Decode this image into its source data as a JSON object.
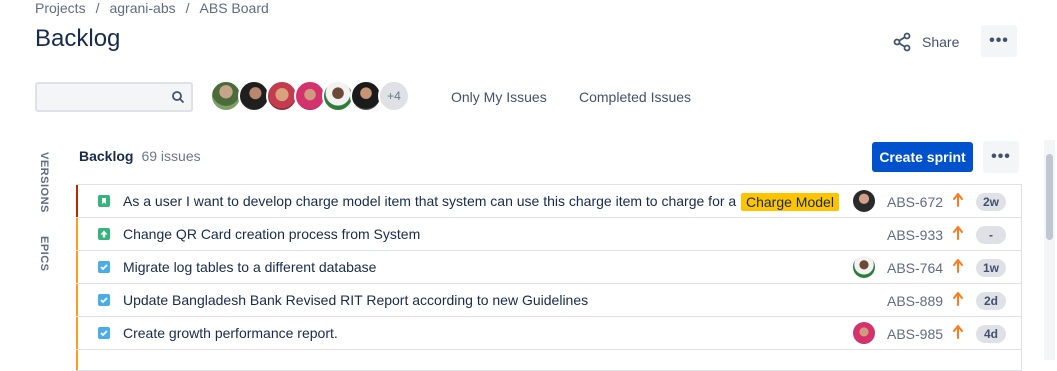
{
  "breadcrumb": {
    "items": [
      "Projects",
      "agrani-abs",
      "ABS Board"
    ],
    "separator": "/"
  },
  "page": {
    "title": "Backlog"
  },
  "header": {
    "share_label": "Share",
    "more_label": "•••"
  },
  "toolbar": {
    "search_placeholder": "",
    "search_value": "",
    "avatar_overflow": "+4",
    "filters": [
      "Only My Issues",
      "Completed Issues"
    ]
  },
  "sidebar": {
    "versions_label": "VERSIONS",
    "epics_label": "EPICS"
  },
  "backlog": {
    "title": "Backlog",
    "count": "69 issues",
    "create_sprint_label": "Create sprint",
    "more_label": "•••"
  },
  "issues": [
    {
      "summary": "As a user I want to develop charge model item that system can use this charge item to charge for a",
      "label": "Charge Model",
      "key": "ABS-672",
      "estimate": "2w",
      "type": "story",
      "stripe_color": "#bf2600",
      "has_avatar": true
    },
    {
      "summary": "Change QR Card creation process from System",
      "label": "",
      "key": "ABS-933",
      "estimate": "-",
      "type": "improvement",
      "stripe_color": "#ff991f",
      "has_avatar": false
    },
    {
      "summary": "Migrate log tables to a different database",
      "label": "",
      "key": "ABS-764",
      "estimate": "1w",
      "type": "task",
      "stripe_color": "#ff991f",
      "has_avatar": true
    },
    {
      "summary": "Update Bangladesh Bank Revised RIT Report according to new Guidelines",
      "label": "",
      "key": "ABS-889",
      "estimate": "2d",
      "type": "task",
      "stripe_color": "#ff991f",
      "has_avatar": false
    },
    {
      "summary": "Create growth performance report.",
      "label": "",
      "key": "ABS-985",
      "estimate": "4d",
      "type": "task",
      "stripe_color": "#ff991f",
      "has_avatar": true
    }
  ],
  "colors": {
    "primary": "#0052cc",
    "story": "#36b37e",
    "task": "#4bade8",
    "priority_high": "#ff7452",
    "label_yellow": "#ffc400"
  }
}
